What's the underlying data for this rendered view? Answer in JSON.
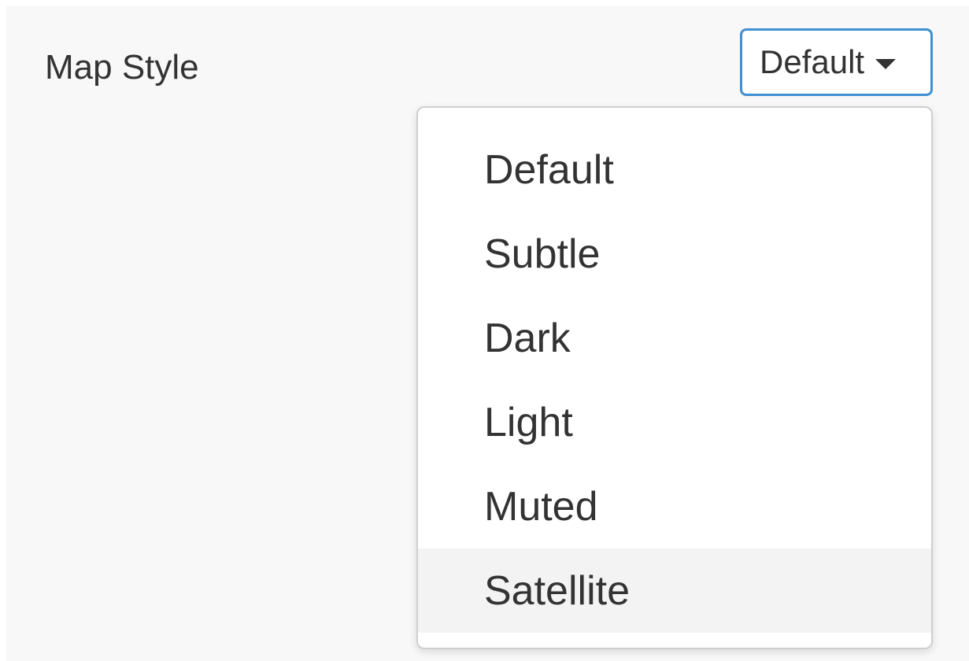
{
  "field": {
    "label": "Map Style"
  },
  "select": {
    "value": "Default"
  },
  "dropdown": {
    "options": [
      "Default",
      "Subtle",
      "Dark",
      "Light",
      "Muted",
      "Satellite"
    ],
    "highlighted": "Satellite"
  },
  "colors": {
    "focus_border": "#3f8fd2",
    "panel_background": "#f8f8f8",
    "highlight_background": "#f3f3f3"
  },
  "icons": {
    "select_caret": "caret-down-icon"
  }
}
